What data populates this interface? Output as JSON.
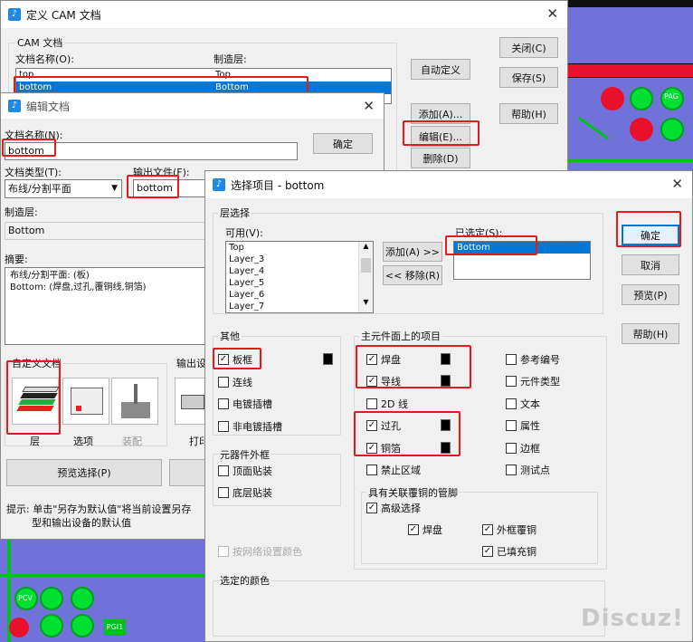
{
  "cam_window": {
    "title": "定义 CAM 文档",
    "group_label": "CAM 文档",
    "col_name": "文档名称(O):",
    "col_layer": "制造层:",
    "rows": [
      {
        "name": "top",
        "layer": "Top"
      },
      {
        "name": "bottom",
        "layer": "Bottom"
      }
    ],
    "buttons": {
      "close": "关闭(C)",
      "auto": "自动定义",
      "save": "保存(S)",
      "add": "添加(A)...",
      "help": "帮助(H)",
      "edit": "编辑(E)...",
      "delete": "删除(D)"
    }
  },
  "edit_window": {
    "title": "编辑文档",
    "doc_name_label": "文档名称(N):",
    "doc_name_value": "bottom",
    "ok": "确定",
    "doc_type_label": "文档类型(T):",
    "doc_type_value": "布线/分割平面",
    "output_label": "输出文件(F):",
    "output_value": "bottom",
    "layer_label": "制造层:",
    "layer_value": "Bottom",
    "summary_label": "摘要:",
    "summary_line1": "布线/分割平面: (板)",
    "summary_line2": "Bottom: (焊盘,过孔,覆铜线,铜箔)",
    "custom_group": "自定义文档",
    "output_group": "输出设",
    "icon_layer": "层",
    "icon_options": "选项",
    "icon_assembly": "装配",
    "icon_print": "打印",
    "preview_button": "预览选择(P)",
    "hint_line1": "提示: 单击\"另存为默认值\"将当前设置另存",
    "hint_line2": "型和输出设备的默认值"
  },
  "select_window": {
    "title": "选择项目 - bottom",
    "layer_group": "层选择",
    "available_label": "可用(V):",
    "available": [
      "Top",
      "Layer_3",
      "Layer_4",
      "Layer_5",
      "Layer_6",
      "Layer_7"
    ],
    "add_button": "添加(A) >>",
    "remove_button": "<< 移除(R)",
    "selected_label": "已选定(S):",
    "selected": [
      "Bottom"
    ],
    "ok": "确定",
    "cancel": "取消",
    "preview": "预览(P)",
    "help": "帮助(H)",
    "other_group": "其他",
    "other_items": [
      {
        "label": "板框",
        "checked": true
      },
      {
        "label": "连线",
        "checked": false
      },
      {
        "label": "电镀插槽",
        "checked": false
      },
      {
        "label": "非电镀插槽",
        "checked": false
      }
    ],
    "comp_group": "元器件外框",
    "comp_items": [
      {
        "label": "顶面贴装",
        "checked": false
      },
      {
        "label": "底层贴装",
        "checked": false
      }
    ],
    "net_color": "按网络设置颜色",
    "main_group": "主元件面上的项目",
    "main_left": [
      {
        "label": "焊盘",
        "checked": true
      },
      {
        "label": "导线",
        "checked": true
      },
      {
        "label": "2D 线",
        "checked": false
      },
      {
        "label": "过孔",
        "checked": true
      },
      {
        "label": "铜箔",
        "checked": true
      },
      {
        "label": "禁止区域",
        "checked": false
      }
    ],
    "main_right": [
      {
        "label": "参考编号",
        "checked": false
      },
      {
        "label": "元件类型",
        "checked": false
      },
      {
        "label": "文本",
        "checked": false
      },
      {
        "label": "属性",
        "checked": false
      },
      {
        "label": "边框",
        "checked": false
      },
      {
        "label": "测试点",
        "checked": false
      }
    ],
    "copper_group": "具有关联覆铜的管脚",
    "advanced": "高级选择",
    "copper_items": [
      {
        "label": "焊盘",
        "checked": true
      },
      {
        "label": "外框覆铜",
        "checked": true
      },
      {
        "label": "已填充铜",
        "checked": true
      }
    ],
    "color_group": "选定的颜色"
  },
  "pcb": {
    "label1": "PCV",
    "label2": "PGI1",
    "label3": "PAG"
  },
  "watermark": "Discuz!",
  "colors": {
    "highlight": "#e51b1b",
    "selection": "#0078d7",
    "pcb_bg": "#7072d9",
    "pad": "#00e030"
  }
}
